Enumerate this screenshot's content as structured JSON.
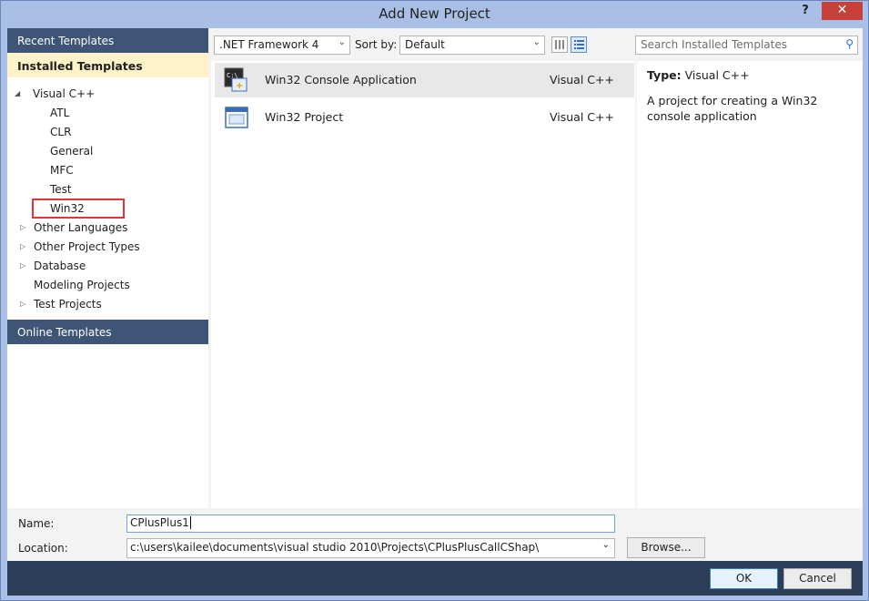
{
  "window": {
    "title": "Add New Project",
    "help_label": "?",
    "close_label": "✕"
  },
  "left_pane": {
    "recent_templates": "Recent Templates",
    "installed_templates": "Installed Templates",
    "online_templates": "Online Templates",
    "tree": [
      {
        "label": "Visual C++",
        "expander": "◢"
      },
      {
        "label": "ATL"
      },
      {
        "label": "CLR"
      },
      {
        "label": "General"
      },
      {
        "label": "MFC"
      },
      {
        "label": "Test"
      },
      {
        "label": "Win32"
      },
      {
        "label": "Other Languages",
        "expander": "▷"
      },
      {
        "label": "Other Project Types",
        "expander": "▷"
      },
      {
        "label": "Database",
        "expander": "▷"
      },
      {
        "label": "Modeling Projects"
      },
      {
        "label": "Test Projects",
        "expander": "▷"
      }
    ]
  },
  "toolbar": {
    "framework": ".NET Framework 4",
    "sort_by_label": "Sort by:",
    "sort_by_value": "Default",
    "search_placeholder": "Search Installed Templates",
    "chevron": "⌄",
    "search_icon": "⚲"
  },
  "templates": [
    {
      "name": "Win32 Console Application",
      "lang": "Visual C++",
      "icon": "console-app-icon",
      "selected": true
    },
    {
      "name": "Win32 Project",
      "lang": "Visual C++",
      "icon": "win32-project-icon",
      "selected": false
    }
  ],
  "details": {
    "type_label": "Type:",
    "type_value": "Visual C++",
    "description": "A project for creating a Win32 console application"
  },
  "form": {
    "name_label": "Name:",
    "name_value": "CPlusPlus1",
    "location_label": "Location:",
    "location_value": "c:\\users\\kailee\\documents\\visual studio 2010\\Projects\\CPlusPlusCallCShap\\",
    "browse_label": "Browse...",
    "ok_label": "OK",
    "cancel_label": "Cancel"
  },
  "colors": {
    "header_dark": "#3e5577",
    "installed_bg": "#fff1c8",
    "highlight_red": "#e2353a",
    "footer": "#2c3d58"
  }
}
